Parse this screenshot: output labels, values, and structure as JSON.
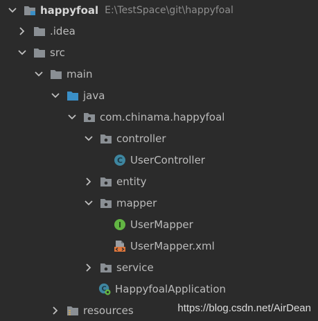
{
  "project": {
    "name": "happyfoal",
    "path": "E:\\TestSpace\\git\\happyfoal"
  },
  "tree": {
    "idea": ".idea",
    "src": "src",
    "main": "main",
    "java": "java",
    "package": "com.chinama.happyfoal",
    "controller": "controller",
    "user_controller": "UserController",
    "entity": "entity",
    "mapper": "mapper",
    "user_mapper": "UserMapper",
    "user_mapper_xml": "UserMapper.xml",
    "service": "service",
    "application": "HappyfoalApplication",
    "resources": "resources"
  },
  "icons": {
    "folder": "folder-icon",
    "package": "package-icon",
    "class": "class-icon",
    "interface": "interface-icon",
    "xml": "xml-file-icon",
    "spring_boot_app": "spring-boot-class-icon"
  },
  "colors": {
    "background": "#2b2b2b",
    "text": "#bbbbbb",
    "folder_gray": "#8a8f94",
    "folder_blue": "#3a8fc7",
    "class_blue": "#3e86a0",
    "interface_green": "#62b543",
    "xml_orange": "#e0773c"
  },
  "watermark": "https://blog.csdn.net/AirDean"
}
